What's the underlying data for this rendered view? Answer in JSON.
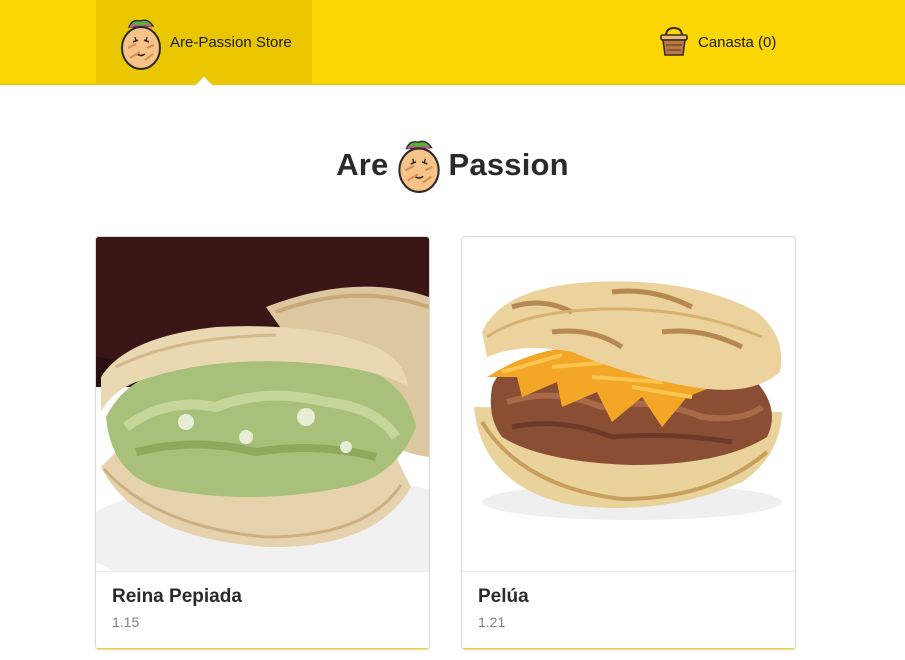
{
  "header": {
    "brand_label": "Are-Passion Store",
    "cart_label": "Canasta (0)",
    "background": "#fbd602",
    "brand_background": "#e9c600"
  },
  "hero": {
    "word_left": "Are",
    "word_right": "Passion",
    "icon": "arepa-mascot-icon"
  },
  "products": [
    {
      "name": "Reina Pepiada",
      "price": "1.15",
      "image": "reina-pepiada-photo"
    },
    {
      "name": "Pelúa",
      "price": "1.21",
      "image": "pelua-photo"
    }
  ]
}
